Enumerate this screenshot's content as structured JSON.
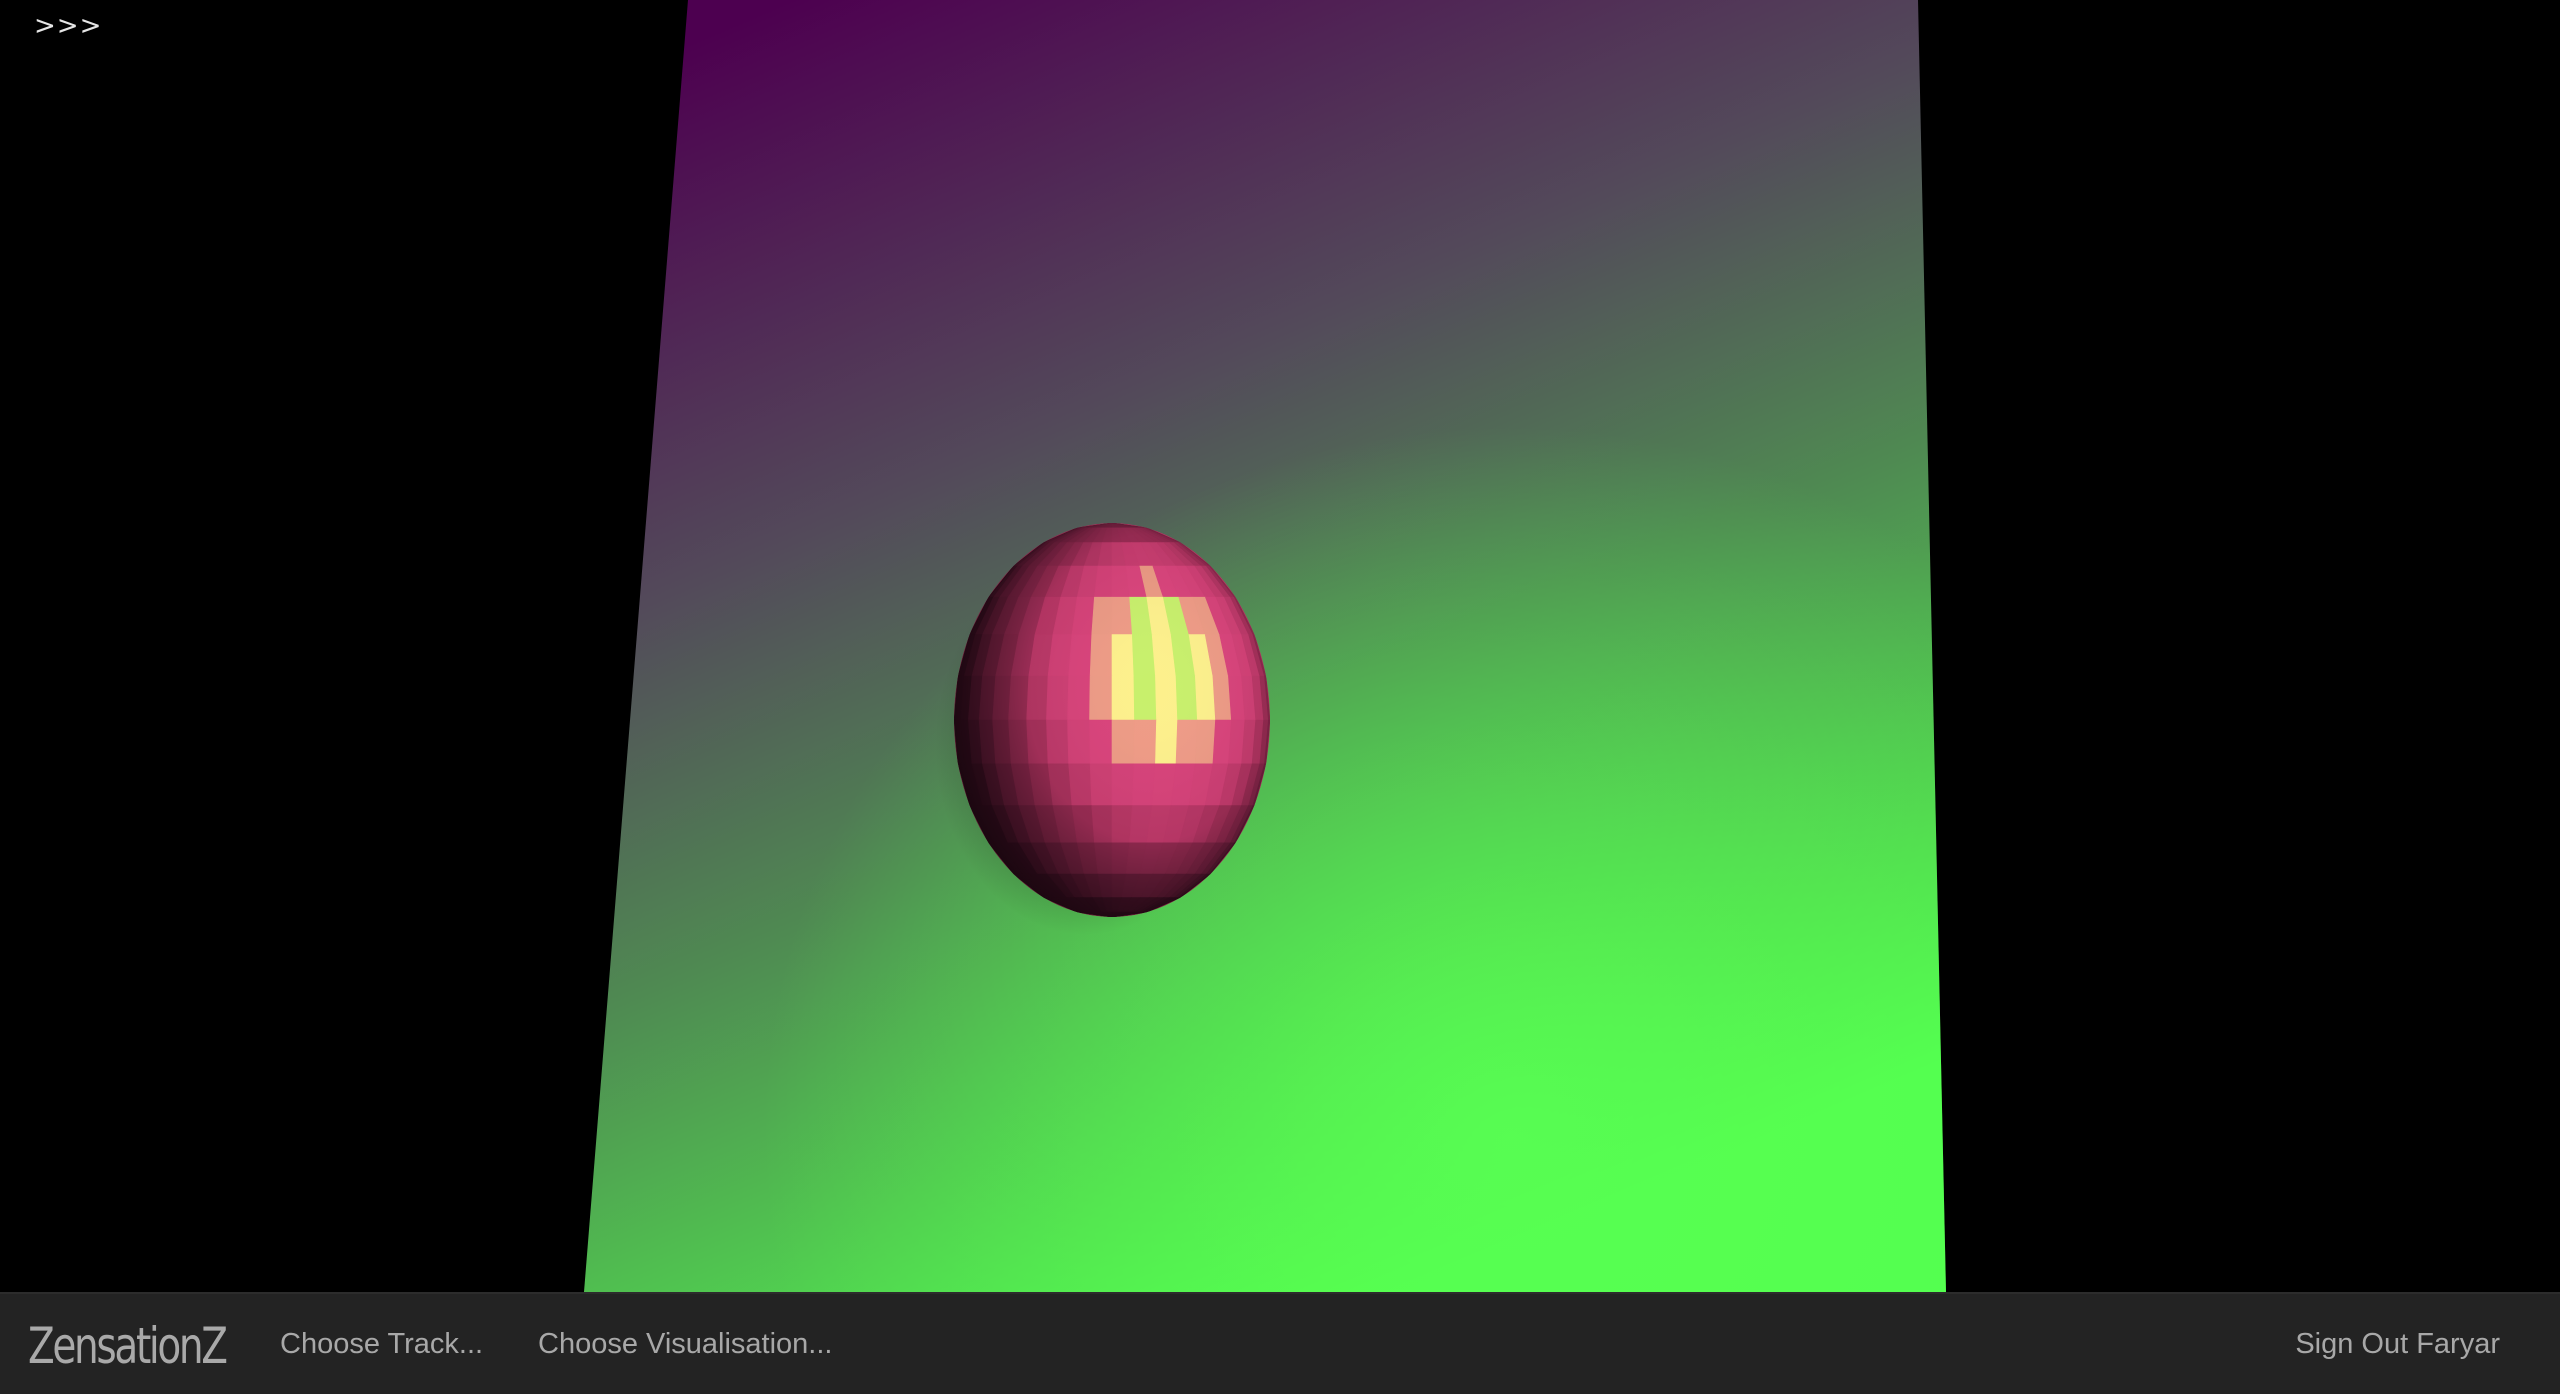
{
  "scene": {
    "toggle_label": ">>>",
    "colors": {
      "background": "#000000",
      "plane_far": "#4d0050",
      "plane_mid": "#4f6b52",
      "plane_near": "#52ff4e",
      "sphere_base": "#c03868",
      "sphere_highlight_green": "#c8f06c",
      "sphere_highlight_yellow": "#fdf08c"
    }
  },
  "navbar": {
    "brand": "ZensationZ",
    "choose_track": "Choose Track...",
    "choose_visualisation": "Choose Visualisation...",
    "sign_out": "Sign Out Faryar",
    "background": "#232323",
    "text_color": "#a8a8a8"
  }
}
